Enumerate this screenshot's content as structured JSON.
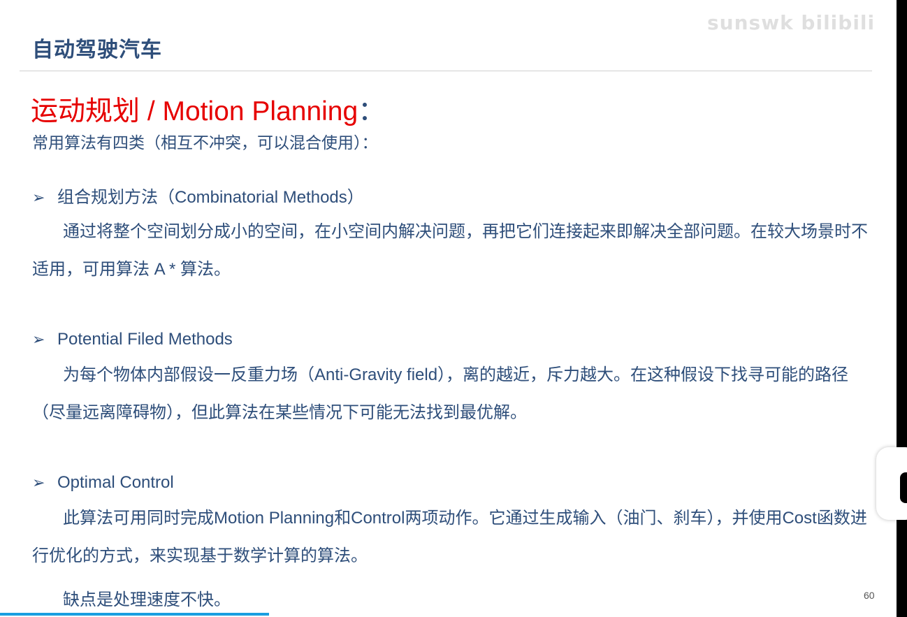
{
  "header": {
    "title": "自动驾驶汽车",
    "watermark": "sunswk bilibili"
  },
  "section": {
    "title": "运动规划 / Motion Planning",
    "title_colon": "：",
    "subtitle": "常用算法有四类（相互不冲突，可以混合使用）："
  },
  "bullets": [
    {
      "arrow": "➢",
      "heading": "组合规划方法（Combinatorial Methods）",
      "body": "通过将整个空间划分成小的空间，在小空间内解决问题，再把它们连接起来即解决全部问题。在较大场景时不适用，可用算法 A * 算法。"
    },
    {
      "arrow": "➢",
      "heading": "Potential Filed Methods",
      "body": "为每个物体内部假设一反重力场（Anti-Gravity field），离的越近，斥力越大。在这种假设下找寻可能的路径（尽量远离障碍物），但此算法在某些情况下可能无法找到最优解。"
    },
    {
      "arrow": "➢",
      "heading": "Optimal Control",
      "body": "此算法可用同时完成Motion Planning和Control两项动作。它通过生成输入（油门、刹车），并使用Cost函数进行优化的方式，来实现基于数学计算的算法。",
      "note": "缺点是处理速度不快。"
    }
  ],
  "footer": {
    "page_number": "60"
  },
  "colors": {
    "heading_blue": "#2e4e7a",
    "accent_red": "#e60000",
    "progress_blue": "#1a9fe0"
  },
  "progress": {
    "fraction": 0.3
  }
}
